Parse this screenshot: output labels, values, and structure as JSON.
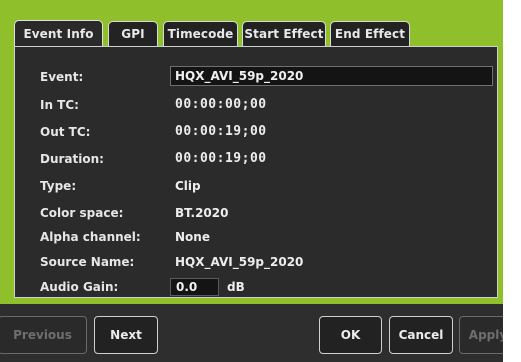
{
  "tabs": [
    {
      "label": "Event Info"
    },
    {
      "label": "GPI"
    },
    {
      "label": "Timecode"
    },
    {
      "label": "Start Effect"
    },
    {
      "label": "End Effect"
    }
  ],
  "fields": {
    "event": {
      "label": "Event:",
      "value": "HQX_AVI_59p_2020"
    },
    "in_tc": {
      "label": "In TC:",
      "value": "00:00:00;00"
    },
    "out_tc": {
      "label": "Out TC:",
      "value": "00:00:19;00"
    },
    "duration": {
      "label": "Duration:",
      "value": "00:00:19;00"
    },
    "type": {
      "label": "Type:",
      "value": "Clip"
    },
    "color_space": {
      "label": "Color space:",
      "value": "BT.2020"
    },
    "alpha_channel": {
      "label": "Alpha channel:",
      "value": "None"
    },
    "source_name": {
      "label": "Source Name:",
      "value": "HQX_AVI_59p_2020"
    },
    "audio_gain": {
      "label": "Audio Gain:",
      "value": "0.0",
      "unit": "dB"
    }
  },
  "buttons": {
    "previous": "Previous",
    "next": "Next",
    "ok": "OK",
    "cancel": "Cancel",
    "apply": "Apply"
  },
  "colors": {
    "accent": "#8fbf2a",
    "panel": "#2b2b2b",
    "field": "#141414"
  }
}
